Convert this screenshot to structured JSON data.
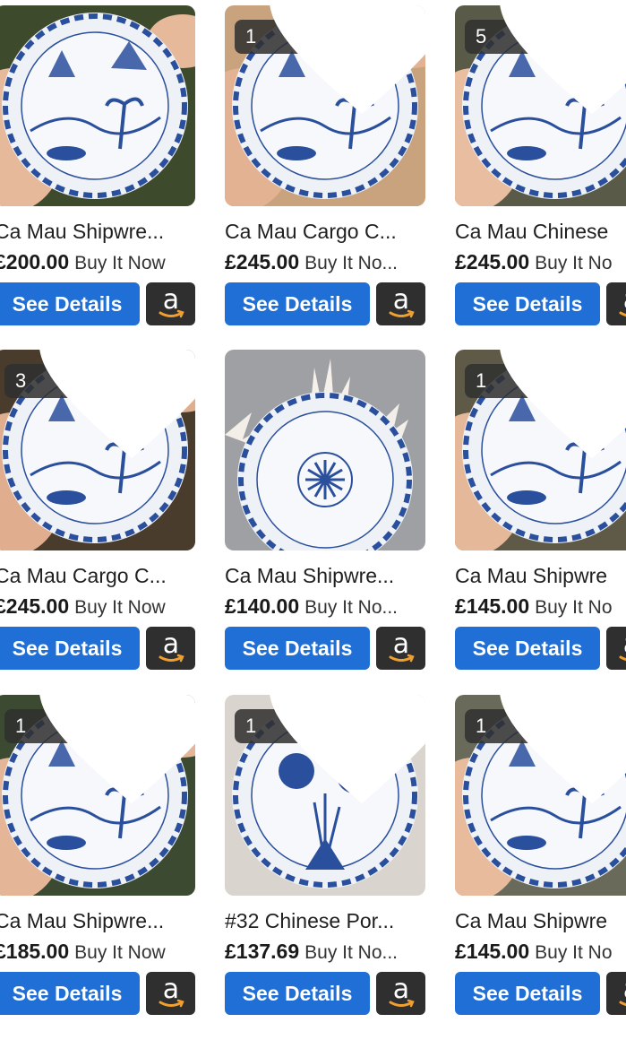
{
  "colors": {
    "accent_button": "#1f6fd6",
    "amazon_button": "#2f2f2f",
    "amazon_smile": "#f0a030",
    "porcelain_blue": "#2a4f9c",
    "porcelain_white": "#eef2f7"
  },
  "icons": {
    "watch": "heart-icon",
    "amazon": "amazon-icon"
  },
  "listings": [
    {
      "title": "Ca Mau Shipwre...",
      "price": "£200.00",
      "buy_label": "Buy It Now",
      "watch_count": "",
      "button_label": "See Details"
    },
    {
      "title": "Ca Mau Cargo C...",
      "price": "£245.00",
      "buy_label": "Buy It No...",
      "watch_count": "1",
      "button_label": "See Details"
    },
    {
      "title": "Ca Mau Chinese",
      "price": "£245.00",
      "buy_label": "Buy It No",
      "watch_count": "5",
      "button_label": "See Details"
    },
    {
      "title": "Ca Mau Cargo C...",
      "price": "£245.00",
      "buy_label": "Buy It Now",
      "watch_count": "3",
      "button_label": "See Details"
    },
    {
      "title": "Ca Mau Shipwre...",
      "price": "£140.00",
      "buy_label": "Buy It No...",
      "watch_count": "",
      "button_label": "See Details"
    },
    {
      "title": "Ca Mau Shipwre",
      "price": "£145.00",
      "buy_label": "Buy It No",
      "watch_count": "1",
      "button_label": "See Details"
    },
    {
      "title": "Ca Mau Shipwre...",
      "price": "£185.00",
      "buy_label": "Buy It Now",
      "watch_count": "1",
      "button_label": "See Details"
    },
    {
      "title": "#32 Chinese Por...",
      "price": "£137.69",
      "buy_label": "Buy It No...",
      "watch_count": "1",
      "button_label": "See Details"
    },
    {
      "title": "Ca Mau Shipwre",
      "price": "£145.00",
      "buy_label": "Buy It No",
      "watch_count": "1",
      "button_label": "See Details"
    }
  ]
}
